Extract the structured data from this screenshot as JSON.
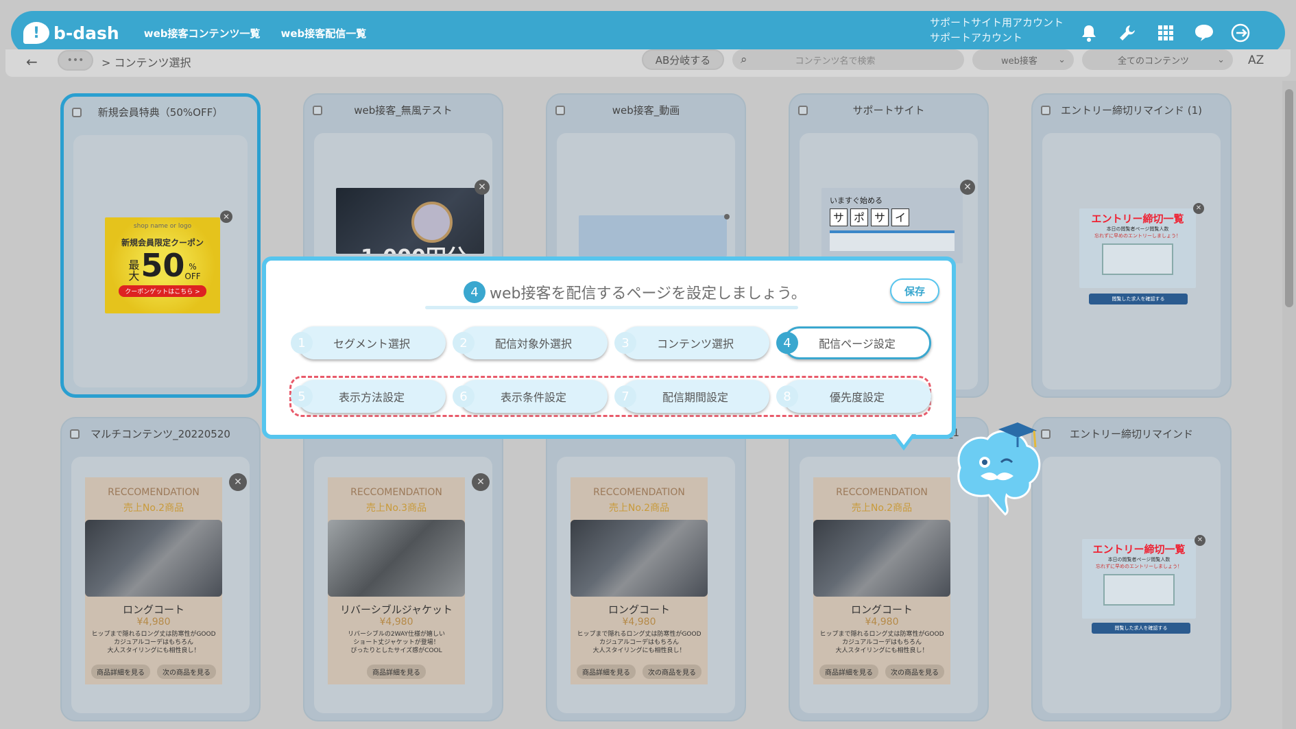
{
  "header": {
    "logo_text": "b-dash",
    "nav": [
      "web接客コンテンツ一覧",
      "web接客配信一覧"
    ],
    "account_line1": "サポートサイト用アカウント",
    "account_line2": "サポートアカウント",
    "icons": [
      "bell-icon",
      "wrench-icon",
      "grid-icon",
      "chat-icon",
      "logout-icon"
    ]
  },
  "toolbar": {
    "back_icon": "arrow-left-icon",
    "breadcrumb_more": "•••",
    "breadcrumb_text": "> コンテンツ選択",
    "ab_button": "AB分岐する",
    "search_placeholder": "コンテンツ名で検索",
    "filter1": "web接客",
    "filter2": "全てのコンテンツ",
    "sort_icon": "AZ"
  },
  "cards": [
    {
      "title": "新規会員特典（50%OFF）"
    },
    {
      "title": "web接客_無風テスト"
    },
    {
      "title": "web接客_動画"
    },
    {
      "title": "サポートサイト"
    },
    {
      "title": "エントリー締切リマインド (1)"
    },
    {
      "title": "マルチコンテンツ_20220520"
    },
    {
      "title": ""
    },
    {
      "title": ""
    },
    {
      "title": "_1"
    },
    {
      "title": "エントリー締切リマインド"
    }
  ],
  "coupon": {
    "logo": "shop name or logo",
    "headline": "新規会員限定クーポン",
    "big": "50",
    "pre": "最大",
    "pct": "%",
    "off": "OFF",
    "cta": "クーポンゲットはこちら >"
  },
  "watch_banner": {
    "text": "1,000円分の"
  },
  "support_banner": {
    "top": "いますぐ始める",
    "chars": [
      "サ",
      "ポ",
      "サ",
      "イ"
    ]
  },
  "entry_banner": {
    "title": "エントリー締切一覧",
    "sub": "本日の閲覧者ページ閲覧人数",
    "ask": "忘れずに早めのエントリーしましょう！",
    "btn": "閲覧した求人を確認する"
  },
  "recos": [
    {
      "label": "RECCOMENDATION",
      "sub": "売上No.2商品",
      "name": "ロングコート",
      "price": "¥4,980",
      "desc": [
        "ヒップまで隠れるロング丈は防寒性がGOOD",
        "カジュアルコーデはもちろん",
        "大人スタイリングにも相性良し！"
      ],
      "btns": [
        "商品詳細を見る",
        "次の商品を見る"
      ]
    },
    {
      "label": "RECCOMENDATION",
      "sub": "売上No.3商品",
      "name": "リバーシブルジャケット",
      "price": "¥4,980",
      "desc": [
        "リバーシブルの2WAY仕様が嬉しい",
        "ショート丈ジャケットが登場！",
        "ぴったりとしたサイズ感がCOOL"
      ],
      "btns": [
        "商品詳細を見る"
      ]
    },
    {
      "label": "RECCOMENDATION",
      "sub": "売上No.2商品",
      "name": "ロングコート",
      "price": "¥4,980",
      "desc": [
        "ヒップまで隠れるロング丈は防寒性がGOOD",
        "カジュアルコーデはもちろん",
        "大人スタイリングにも相性良し！"
      ],
      "btns": [
        "商品詳細を見る",
        "次の商品を見る"
      ]
    },
    {
      "label": "RECCOMENDATION",
      "sub": "売上No.2商品",
      "name": "ロングコート",
      "price": "¥4,980",
      "desc": [
        "ヒップまで隠れるロング丈は防寒性がGOOD",
        "カジュアルコーデはもちろん",
        "大人スタイリングにも相性良し！"
      ],
      "btns": [
        "商品詳細を見る",
        "次の商品を見る"
      ]
    }
  ],
  "dialog": {
    "step_number": "4",
    "title": "web接客を配信するページを設定しましょう。",
    "save": "保存",
    "steps": [
      {
        "n": "1",
        "label": "セグメント選択"
      },
      {
        "n": "2",
        "label": "配信対象外選択"
      },
      {
        "n": "3",
        "label": "コンテンツ選択"
      },
      {
        "n": "4",
        "label": "配信ページ設定"
      },
      {
        "n": "5",
        "label": "表示方法設定"
      },
      {
        "n": "6",
        "label": "表示条件設定"
      },
      {
        "n": "7",
        "label": "配信期間設定"
      },
      {
        "n": "8",
        "label": "優先度設定"
      }
    ],
    "active_step": 4
  },
  "colors": {
    "brand": "#3aa7cf",
    "dialog_border": "#56c5ee",
    "dash": "#e85a6a"
  }
}
